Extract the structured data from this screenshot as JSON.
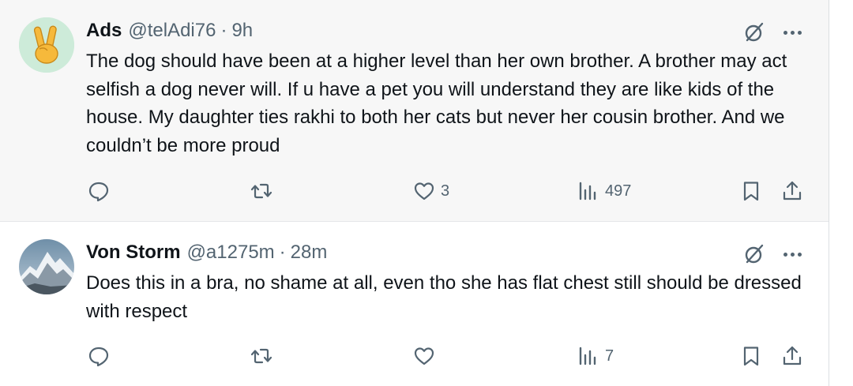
{
  "tweets": [
    {
      "name": "Ads",
      "handle": "@telAdi76",
      "separator": "·",
      "time": "9h",
      "avatar_icon": "victory-hand-emoji",
      "text": "The dog should have been at a higher level than her own brother. A brother may act selfish a dog never will. If u have a pet you will understand they are like kids of the house. My daughter ties rakhi to both her cats but never her cousin brother. And we couldn’t be more proud",
      "reply_count": "",
      "retweet_count": "",
      "like_count": "3",
      "view_count": "497"
    },
    {
      "name": "Von Storm",
      "handle": "@a1275m",
      "separator": "·",
      "time": "28m",
      "avatar_icon": "mountain-photo",
      "text": "Does this in a bra,  no shame at all,  even tho she has flat chest still should be dressed with respect",
      "reply_count": "",
      "retweet_count": "",
      "like_count": "",
      "view_count": "7"
    }
  ],
  "colors": {
    "text_primary": "#0f1419",
    "text_secondary": "#536471",
    "highlight_bg": "#f7f7f7"
  },
  "icons": [
    "grok-icon",
    "more-icon",
    "reply-icon",
    "retweet-icon",
    "like-icon",
    "views-icon",
    "bookmark-icon",
    "share-icon"
  ]
}
